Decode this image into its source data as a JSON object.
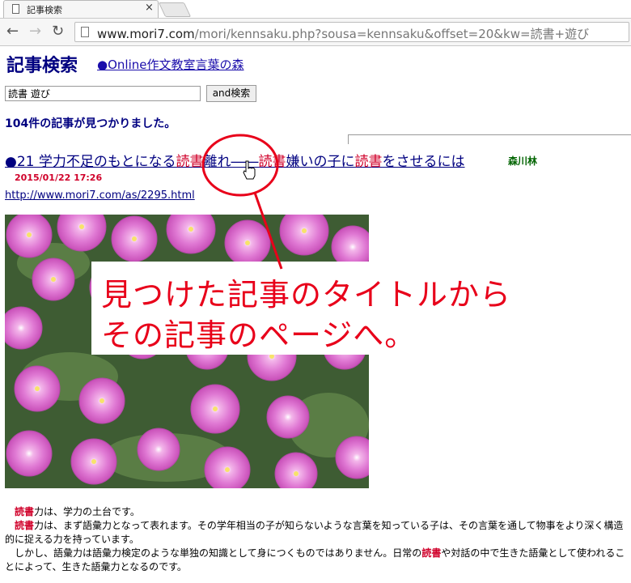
{
  "browser": {
    "tab_title": "記事検索",
    "close_glyph": "×",
    "url_host": "www.mori7.com",
    "url_path": "/mori/kennsaku.php?sousa=kennsaku&offset=20&kw=読書+遊び"
  },
  "page": {
    "heading": "記事検索",
    "site_link": "●Online作文教室言葉の森",
    "search_value": "読書 遊び",
    "search_button": "and検索",
    "result_count": "104件の記事が見つかりました。"
  },
  "article": {
    "title_parts": [
      "●21 学力不足のもとになる",
      "読書",
      "離れ――",
      "読書",
      "嫌いの子に",
      "読書",
      "をさせるには"
    ],
    "author": "森川林",
    "date": "2015/01/22 17:26",
    "link": "http://www.mori7.com/as/2295.html"
  },
  "annotation": {
    "line1": "見つけた記事のタイトルから",
    "line2": "その記事のページへ。"
  },
  "body": {
    "p1_kw": "読書",
    "p1_rest": "力は、学力の土台です。",
    "p2_kw": "読書",
    "p2_rest": "力は、まず語彙力となって表れます。その学年相当の子が知らないような言葉を知っている子は、その言葉を通して物事をより深く構造的に捉える力を持っています。",
    "p3_a": "しかし、語彙力は語彙力検定のような単独の知識として身につくものではありません。日常の",
    "p3_kw": "読書",
    "p3_b": "や対話の中で生きた語彙として使われることによって、生きた語彙力となるのです。"
  }
}
